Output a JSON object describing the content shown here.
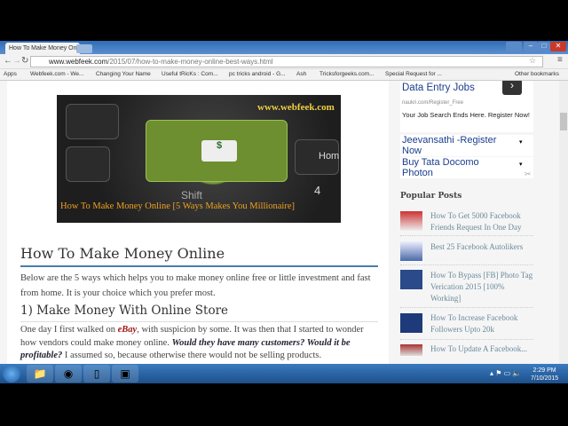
{
  "browser": {
    "tab_title": "How To Make Money Onl",
    "url_domain": "www.webfeek.com",
    "url_path": "/2015/07/how-to-make-money-online-best-ways.html"
  },
  "bookmarks": [
    "Apps",
    "Webfeek.com - We...",
    "Changing Your Name",
    "Useful tRicKs : Com...",
    "pc tricks android - G...",
    "Ash",
    "Tricksforgeeks.com...",
    "Special Request for ...",
    "Other bookmarks"
  ],
  "hero": {
    "site": "www.webfeek.com",
    "caption": "How To Make Money Online [5 Ways Makes You Millionaire]",
    "key_label": "Shift",
    "key_label2": "Hom",
    "key_num": "4"
  },
  "article": {
    "title": "How To Make Money Online",
    "intro": "Below are the 5 ways which helps you to make money online free or little investment and fast from home. It is your choice which you prefer most.",
    "h2": "1) Make Money With Online Store",
    "p1a": "One day I first walked on ",
    "p1link": "eBay",
    "p1b": ", with suspicion by some. It was then that I started to wonder how vendors could make money online. ",
    "p1em": "Would they have many customers? Would it be profitable?",
    "p1c": " I assumed so, because otherwise there would not be selling products."
  },
  "ads": {
    "title": "Data Entry Jobs",
    "url": "naukri.com/Register_Free",
    "desc": "Your Job Search Ends Here. Register Now!",
    "link1": "Jeevansathi -Register Now",
    "link2": "Buy Tata Docomo Photon"
  },
  "popular": {
    "heading": "Popular Posts",
    "posts": [
      "How To Get 5000 Facebook Friends Request In One Day",
      "Best 25 Facebook Autolikers",
      "How To Bypass [FB] Photo Tag Verication 2015 [100% Working]",
      "How To Increase Facebook Followers Upto 20k",
      "How To Update A Facebook..."
    ]
  },
  "taskbar": {
    "time": "2:29 PM",
    "date": "7/10/2015"
  }
}
